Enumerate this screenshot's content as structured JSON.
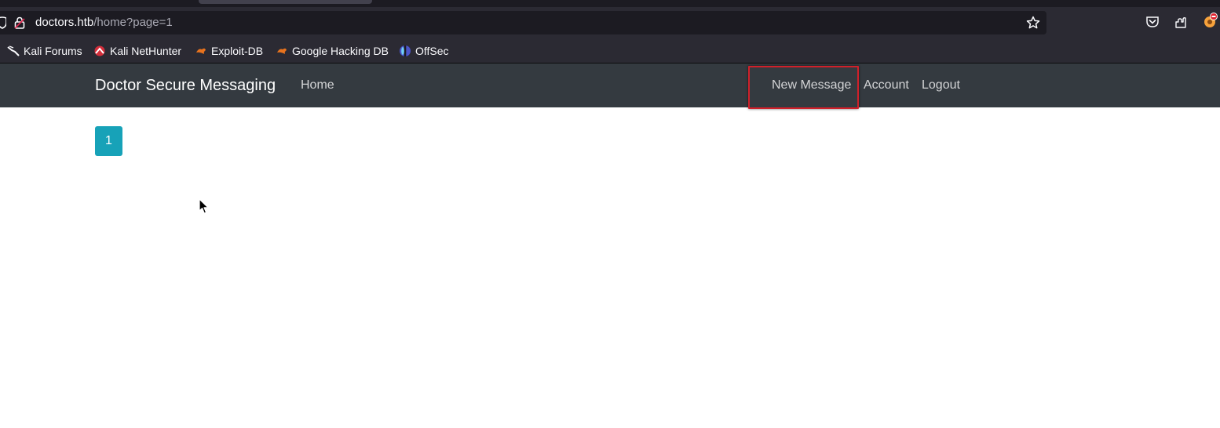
{
  "browser": {
    "url_host": "doctors.htb",
    "url_path": "/home?page=1",
    "bookmarks": [
      {
        "label": "Kali Forums",
        "icon": "kali-dragon-icon"
      },
      {
        "label": "Kali NetHunter",
        "icon": "nethunter-icon"
      },
      {
        "label": "Exploit-DB",
        "icon": "exploitdb-icon"
      },
      {
        "label": "Google Hacking DB",
        "icon": "ghdb-icon"
      },
      {
        "label": "OffSec",
        "icon": "offsec-icon"
      }
    ]
  },
  "site": {
    "brand": "Doctor Secure Messaging",
    "nav_left": [
      {
        "label": "Home"
      }
    ],
    "nav_right": [
      {
        "label": "New Message"
      },
      {
        "label": "Account"
      },
      {
        "label": "Logout"
      }
    ]
  },
  "pagination": {
    "pages": [
      "1"
    ],
    "active_color": "#17a2b8"
  },
  "colors": {
    "navbar": "#343a40",
    "highlight": "#d0202a"
  }
}
